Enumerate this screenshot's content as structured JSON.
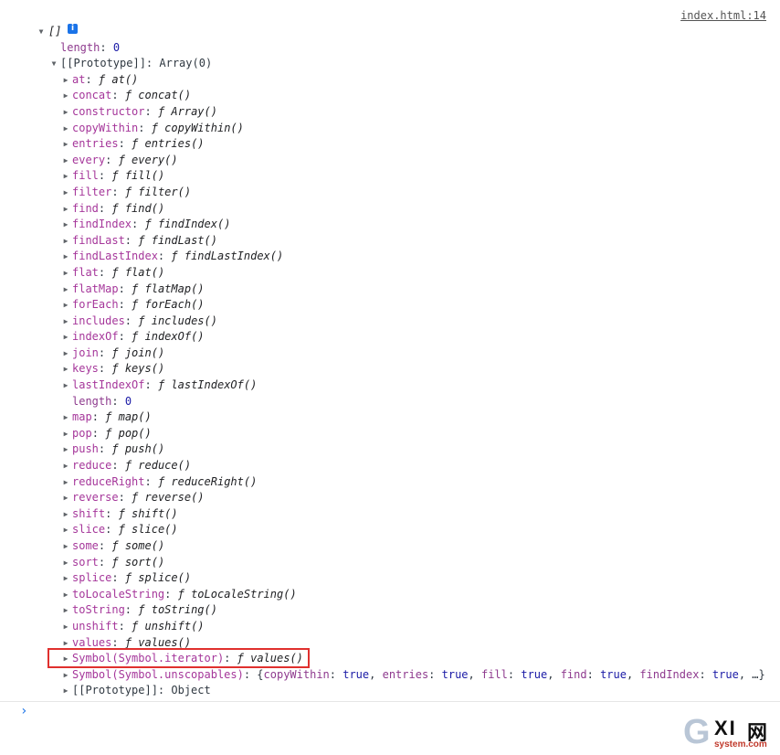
{
  "source_link": "index.html:14",
  "root": {
    "label": "[]",
    "info_icon": "info-icon",
    "length_key": "length",
    "length_value": "0",
    "prototype_key": "[[Prototype]]",
    "prototype_value": "Array(0)"
  },
  "methods": [
    {
      "key": "at",
      "value": "at()"
    },
    {
      "key": "concat",
      "value": "concat()"
    },
    {
      "key": "constructor",
      "value": "Array()"
    },
    {
      "key": "copyWithin",
      "value": "copyWithin()"
    },
    {
      "key": "entries",
      "value": "entries()"
    },
    {
      "key": "every",
      "value": "every()"
    },
    {
      "key": "fill",
      "value": "fill()"
    },
    {
      "key": "filter",
      "value": "filter()"
    },
    {
      "key": "find",
      "value": "find()"
    },
    {
      "key": "findIndex",
      "value": "findIndex()"
    },
    {
      "key": "findLast",
      "value": "findLast()"
    },
    {
      "key": "findLastIndex",
      "value": "findLastIndex()"
    },
    {
      "key": "flat",
      "value": "flat()"
    },
    {
      "key": "flatMap",
      "value": "flatMap()"
    },
    {
      "key": "forEach",
      "value": "forEach()"
    },
    {
      "key": "includes",
      "value": "includes()"
    },
    {
      "key": "indexOf",
      "value": "indexOf()"
    },
    {
      "key": "join",
      "value": "join()"
    },
    {
      "key": "keys",
      "value": "keys()"
    },
    {
      "key": "lastIndexOf",
      "value": "lastIndexOf()"
    }
  ],
  "proto_length": {
    "key": "length",
    "value": "0"
  },
  "methods2": [
    {
      "key": "map",
      "value": "map()"
    },
    {
      "key": "pop",
      "value": "pop()"
    },
    {
      "key": "push",
      "value": "push()"
    },
    {
      "key": "reduce",
      "value": "reduce()"
    },
    {
      "key": "reduceRight",
      "value": "reduceRight()"
    },
    {
      "key": "reverse",
      "value": "reverse()"
    },
    {
      "key": "shift",
      "value": "shift()"
    },
    {
      "key": "slice",
      "value": "slice()"
    },
    {
      "key": "some",
      "value": "some()"
    },
    {
      "key": "sort",
      "value": "sort()"
    },
    {
      "key": "splice",
      "value": "splice()"
    },
    {
      "key": "toLocaleString",
      "value": "toLocaleString()"
    },
    {
      "key": "toString",
      "value": "toString()"
    },
    {
      "key": "unshift",
      "value": "unshift()"
    },
    {
      "key": "values",
      "value": "values()"
    }
  ],
  "symbol_iterator": {
    "key": "Symbol(Symbol.iterator)",
    "value": "values()"
  },
  "symbol_unscopables": {
    "key": "Symbol(Symbol.unscopables)",
    "open": "{",
    "pairs": [
      {
        "k": "copyWithin",
        "v": "true"
      },
      {
        "k": "entries",
        "v": "true"
      },
      {
        "k": "fill",
        "v": "true"
      },
      {
        "k": "find",
        "v": "true"
      },
      {
        "k": "findIndex",
        "v": "true"
      }
    ],
    "ellipsis": "…}"
  },
  "inner_prototype": {
    "key": "[[Prototype]]",
    "value": "Object"
  },
  "fn_marker": "ƒ",
  "prompt_symbol": "›",
  "watermark": {
    "g": "G",
    "xi": "XI",
    "net": "网",
    "sub": "system.com"
  }
}
